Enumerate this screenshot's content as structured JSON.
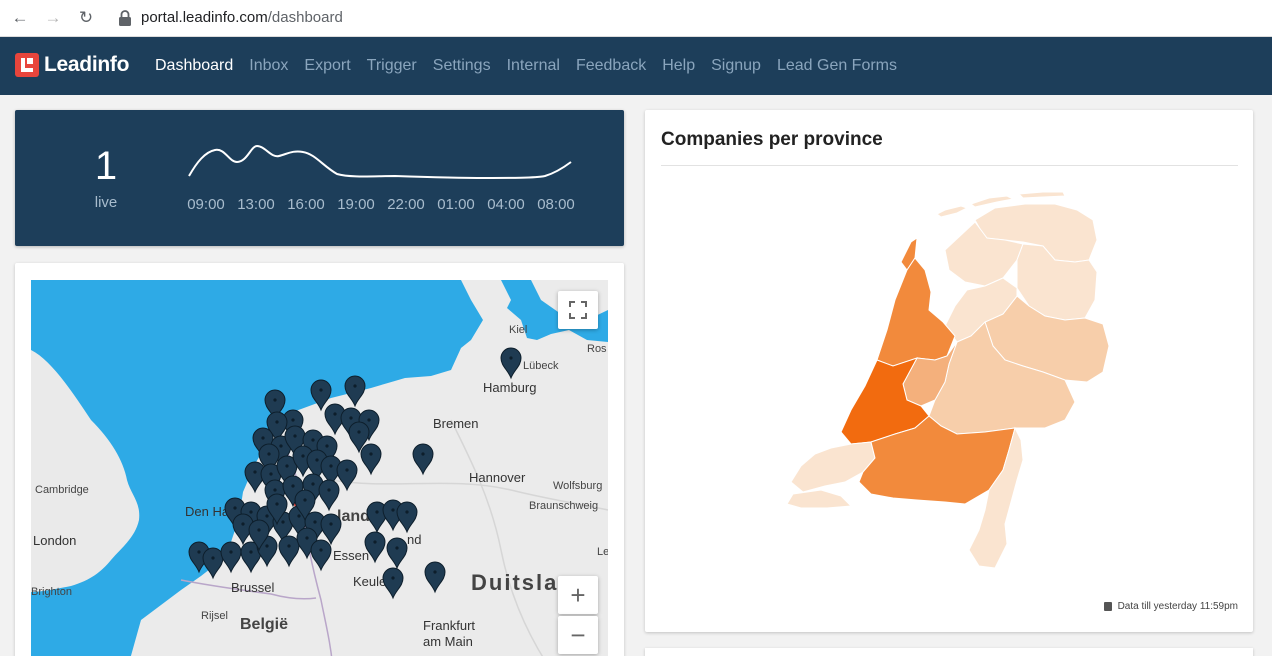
{
  "browser": {
    "url_host": "portal.leadinfo.com",
    "url_path": "/dashboard"
  },
  "app": {
    "logo_text": "Leadinfo",
    "menu": [
      {
        "label": "Dashboard",
        "active": true
      },
      {
        "label": "Inbox",
        "active": false
      },
      {
        "label": "Export",
        "active": false
      },
      {
        "label": "Trigger",
        "active": false
      },
      {
        "label": "Settings",
        "active": false
      },
      {
        "label": "Internal",
        "active": false
      },
      {
        "label": "Feedback",
        "active": false
      },
      {
        "label": "Help",
        "active": false
      },
      {
        "label": "Signup",
        "active": false
      },
      {
        "label": "Lead Gen Forms",
        "active": false
      }
    ]
  },
  "live": {
    "count": "1",
    "label": "live",
    "ticks": [
      "09:00",
      "13:00",
      "16:00",
      "19:00",
      "22:00",
      "01:00",
      "04:00",
      "08:00"
    ]
  },
  "map": {
    "labels": {
      "kiel": "Kiel",
      "lubeck": "Lübeck",
      "ros": "Ros",
      "hamburg": "Hamburg",
      "bremen": "Bremen",
      "hannover": "Hannover",
      "wolfsburg": "Wolfsburg",
      "braunschweig": "Braunschweig",
      "cambridge": "Cambridge",
      "london": "London",
      "brighton": "Brighton",
      "rijsel": "Rijsel",
      "belgie": "België",
      "brussel": "Brussel",
      "den_haag": "Den Haag",
      "nederland_frag": "land",
      "essen": "Essen",
      "dortmund_frag": "nd",
      "keulen": "Keulen",
      "duitsland": "Duitsla",
      "frankfurt_1": "Frankfurt",
      "frankfurt_2": "am Main",
      "le": "Le"
    },
    "zoom_in": "+",
    "zoom_out": "−"
  },
  "provinces": {
    "title": "Companies per province",
    "footnote": "Data till yesterday 11:59pm",
    "colors": {
      "darkest": "#f26b0f",
      "dark": "#f28a3c",
      "mid": "#f4b07c",
      "light": "#f7ceaa",
      "lightest": "#fae4d0"
    }
  }
}
